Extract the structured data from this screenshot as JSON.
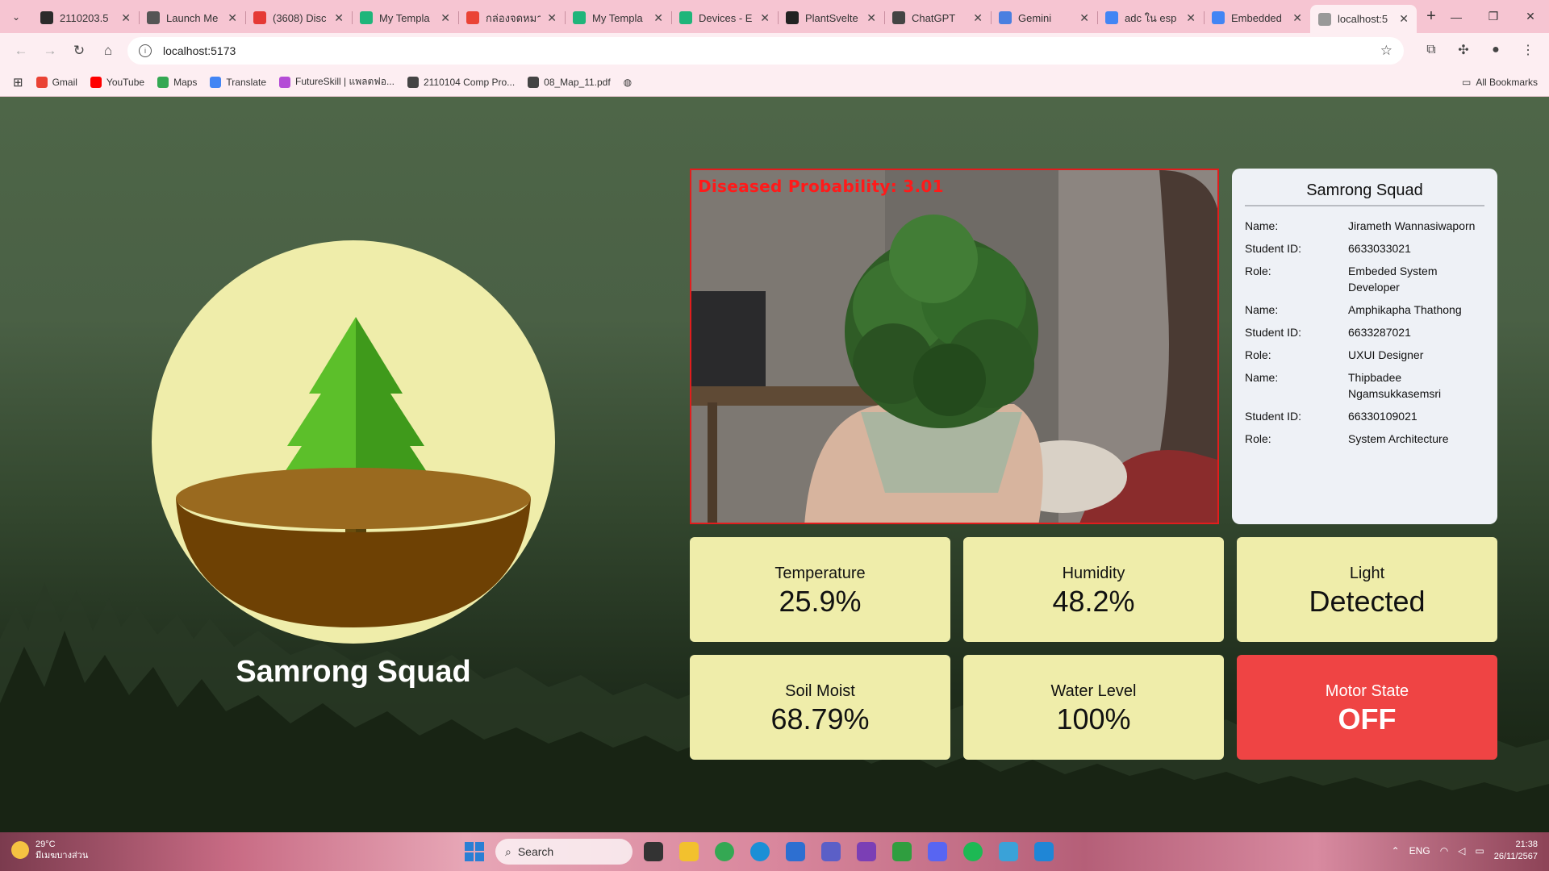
{
  "browser": {
    "tabs": [
      {
        "label": "2110203.5",
        "icon_color": "#2b2b2b"
      },
      {
        "label": "Launch Me",
        "icon_color": "#555555"
      },
      {
        "label": "(3608) Disc",
        "icon_color": "#e53935"
      },
      {
        "label": "My Templa",
        "icon_color": "#1fb57a"
      },
      {
        "label": "กล่องจดหมา",
        "icon_color": "#ea4335"
      },
      {
        "label": "My Templa",
        "icon_color": "#1fb57a"
      },
      {
        "label": "Devices - E",
        "icon_color": "#1fb57a"
      },
      {
        "label": "PlantSvelte",
        "icon_color": "#222222"
      },
      {
        "label": "ChatGPT",
        "icon_color": "#444444"
      },
      {
        "label": "Gemini",
        "icon_color": "#4a7fe0"
      },
      {
        "label": "adc ใน esp",
        "icon_color": "#4285f4"
      },
      {
        "label": "Embedded",
        "icon_color": "#4285f4"
      },
      {
        "label": "localhost:5",
        "icon_color": "#999999"
      }
    ],
    "close_glyph": "✕",
    "new_tab_glyph": "+",
    "url": "localhost:5173",
    "bookmarks": [
      {
        "label": "Gmail",
        "icon_color": "#ea4335"
      },
      {
        "label": "YouTube",
        "icon_color": "#ff0000"
      },
      {
        "label": "Maps",
        "icon_color": "#34a853"
      },
      {
        "label": "Translate",
        "icon_color": "#4285f4"
      },
      {
        "label": "FutureSkill | แพลตฟอ...",
        "icon_color": "#b44cd6"
      },
      {
        "label": "2110104 Comp Pro...",
        "icon_color": "#444444"
      },
      {
        "label": "08_Map_11.pdf",
        "icon_color": "#444444"
      }
    ],
    "all_bookmarks": "All Bookmarks"
  },
  "app": {
    "hero_title": "Samrong Squad",
    "camera": {
      "probability_text": "Diseased Probability: 3.01"
    },
    "team": {
      "title": "Samrong Squad",
      "keys": {
        "name": "Name:",
        "id": "Student ID:",
        "role": "Role:"
      },
      "members": [
        {
          "name": "Jirameth Wannasiwaporn",
          "id": "6633033021",
          "role": "Embeded System Developer"
        },
        {
          "name": "Amphikapha Thathong",
          "id": "6633287021",
          "role": "UXUI Designer"
        },
        {
          "name": "Thipbadee Ngamsukkasemsri",
          "id": "66330109021",
          "role": "System Architecture"
        }
      ]
    },
    "stats": [
      {
        "label": "Temperature",
        "value": "25.9%"
      },
      {
        "label": "Humidity",
        "value": "48.2%"
      },
      {
        "label": "Light",
        "value": "Detected"
      },
      {
        "label": "Soil Moist",
        "value": "68.79%"
      },
      {
        "label": "Water Level",
        "value": "100%"
      },
      {
        "label": "Motor State",
        "value": "OFF",
        "alert": true
      }
    ],
    "colors": {
      "card": "#efedaa",
      "alert": "#ef4444",
      "prob_text": "#ff1a1a"
    }
  },
  "taskbar": {
    "weather_temp": "29°C",
    "weather_desc": "มีเมฆบางส่วน",
    "search_placeholder": "Search",
    "lang": "ENG",
    "time": "21:38",
    "date": "26/11/2567"
  }
}
